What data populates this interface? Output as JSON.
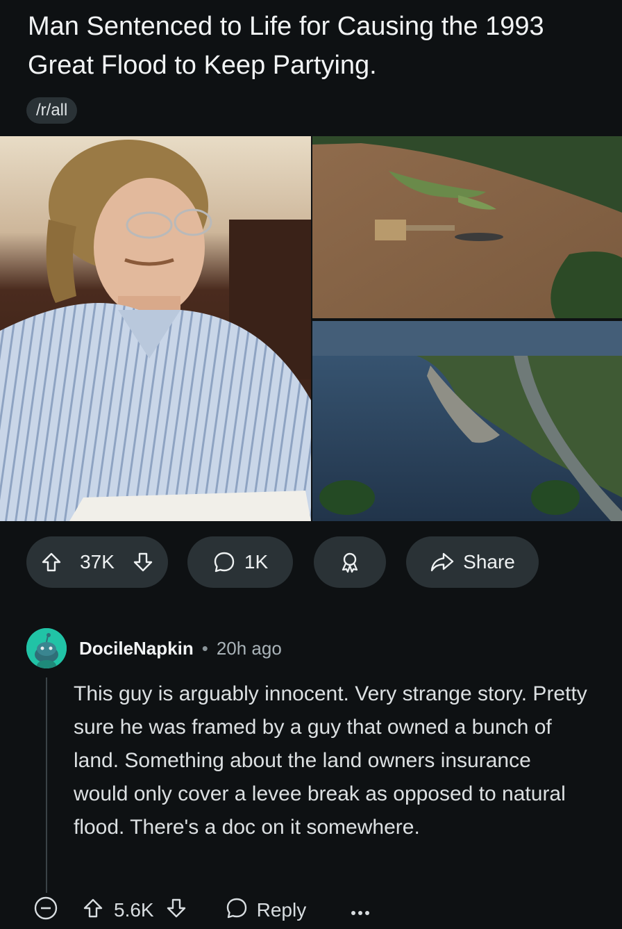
{
  "post": {
    "title": "Man Sentenced to Life for Causing the 1993 Great Flood to Keep Partying.",
    "subreddit": "/r/all",
    "upvotes": "37K",
    "comments": "1K",
    "share_label": "Share"
  },
  "colors": {
    "background": "#0e1113",
    "button_bg": "#2a3236",
    "avatar": "#21c3a6",
    "thread_line": "#3a4347"
  },
  "comment": {
    "author": "DocileNapkin",
    "separator": "•",
    "time": "20h ago",
    "body": "This guy is arguably innocent. Very strange story. Pretty sure he was framed by a guy that owned a bunch of land. Something about the land owners insurance would only cover a levee break as opposed to natural flood. There's a doc on it somewhere.",
    "score": "5.6K",
    "reply_label": "Reply"
  },
  "icons": [
    "upvote-icon",
    "downvote-icon",
    "comment-icon",
    "award-icon",
    "share-icon",
    "collapse-icon",
    "more-icon"
  ]
}
